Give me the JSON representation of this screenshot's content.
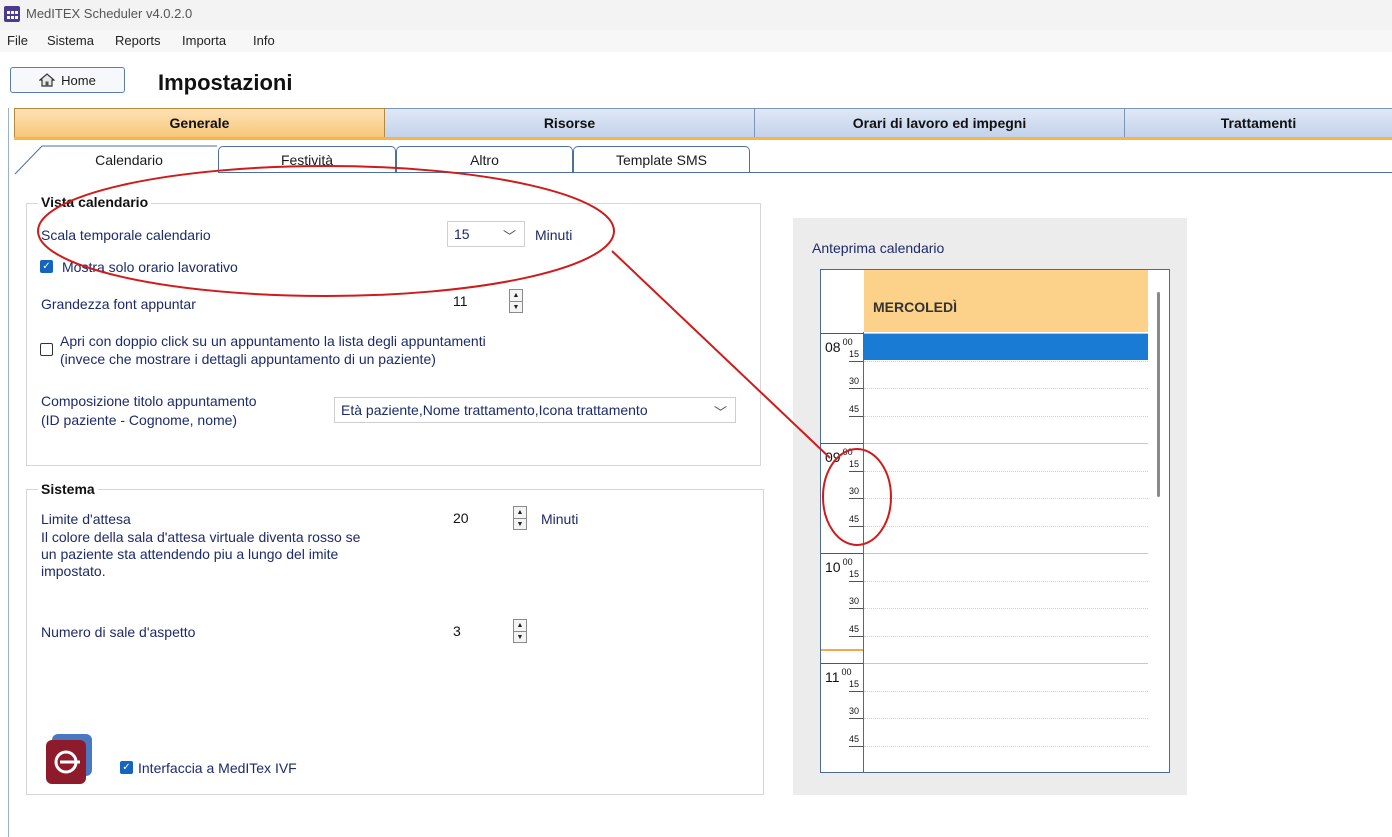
{
  "window": {
    "title": "MedITEX Scheduler v4.0.2.0"
  },
  "menu": [
    "File",
    "Sistema",
    "Reports",
    "Importa",
    "Info"
  ],
  "header": {
    "home_label": "Home",
    "page_title": "Impostazioni"
  },
  "main_tabs": [
    "Generale",
    "Risorse",
    "Orari di lavoro ed impegni",
    "Trattamenti"
  ],
  "sub_tabs": [
    "Calendario",
    "Festività",
    "Altro",
    "Template SMS"
  ],
  "vista": {
    "title": "Vista calendario",
    "scala_label": "Scala temporale calendario",
    "scala_value": "15",
    "scala_unit": "Minuti",
    "solo_lavorativo_label": "Mostra solo orario lavorativo",
    "solo_lavorativo_checked": true,
    "font_label": "Grandezza font appuntar",
    "font_value": "11",
    "doppio_click_line1": "Apri con doppio click su un appuntamento la lista degli appuntamenti",
    "doppio_click_line2": "(invece che mostrare i dettagli appuntamento di un paziente)",
    "doppio_click_checked": false,
    "composizione_line1": "Composizione titolo appuntamento",
    "composizione_line2": "(ID paziente - Cognome, nome)",
    "composizione_value": "Età paziente,Nome trattamento,Icona trattamento"
  },
  "sistema": {
    "title": "Sistema",
    "limite_label": "Limite d'attesa",
    "limite_desc": "Il colore della sala d'attesa virtuale diventa rosso se un paziente sta attendendo piu a lungo del imite impostato.",
    "limite_value": "20",
    "limite_unit": "Minuti",
    "sale_label": "Numero di sale d'aspetto",
    "sale_value": "3",
    "ivf_label": "Interfaccia a MedITex IVF",
    "ivf_checked": true
  },
  "preview": {
    "label": "Anteprima calendario",
    "day": "MERCOLEDÌ",
    "hours": [
      {
        "hour": "08",
        "minutes": [
          "00",
          "15",
          "30",
          "45"
        ]
      },
      {
        "hour": "09",
        "minutes": [
          "00",
          "15",
          "30",
          "45"
        ]
      },
      {
        "hour": "10",
        "minutes": [
          "00",
          "15",
          "30",
          "45"
        ]
      },
      {
        "hour": "11",
        "minutes": [
          "00",
          "15",
          "30",
          "45"
        ]
      }
    ]
  },
  "colors": {
    "active_tab": "#f7c77a",
    "tab": "#c4d3ea",
    "calendar_header": "#fcd189",
    "appointment": "#1a7bd4",
    "annotation": "#d11a1a"
  }
}
